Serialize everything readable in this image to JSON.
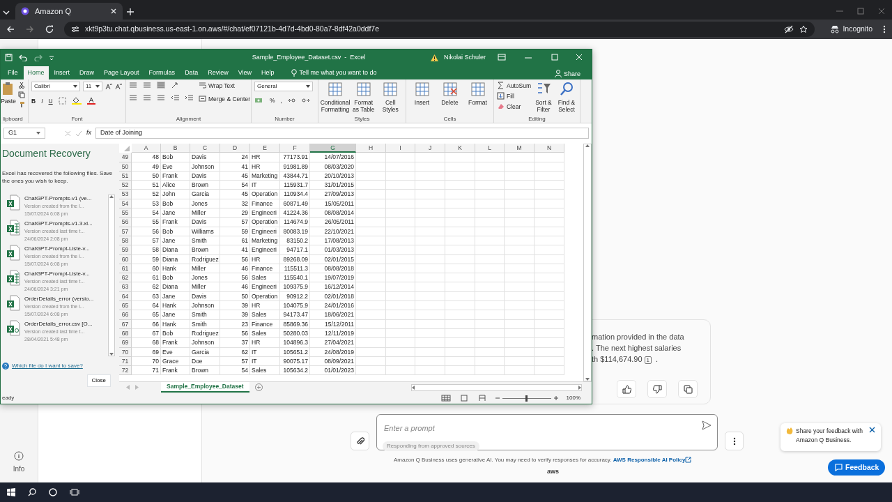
{
  "browser": {
    "tab_title": "Amazon Q",
    "url": "xkt9p3tu.chat.qbusiness.us-east-1.on.aws/#/chat/ef07121b-4d7d-4bd0-80a7-8df42a0ddf7e",
    "incognito": "Incognito"
  },
  "excel": {
    "title": "Sample_Employee_Dataset.csv  -  Excel",
    "user": "Nikolai Schuler",
    "tabs": [
      {
        "label": "File",
        "selected": false
      },
      {
        "label": "Home",
        "selected": true
      },
      {
        "label": "Insert",
        "selected": false
      },
      {
        "label": "Draw",
        "selected": false
      },
      {
        "label": "Page Layout",
        "selected": false
      },
      {
        "label": "Formulas",
        "selected": false
      },
      {
        "label": "Data",
        "selected": false
      },
      {
        "label": "Review",
        "selected": false
      },
      {
        "label": "View",
        "selected": false
      },
      {
        "label": "Help",
        "selected": false
      }
    ],
    "tell_me": "Tell me what you want to do",
    "share": "Share",
    "ribbon": [
      {
        "kind": "clipboard",
        "label": "lipboard",
        "buttons": [
          "Paste"
        ]
      },
      {
        "kind": "font",
        "label": "Font",
        "font": "Calibri",
        "size": "11",
        "styles": [
          "B",
          "I",
          "U"
        ]
      },
      {
        "kind": "alignment",
        "label": "Alignment",
        "buttons": [
          "Wrap Text",
          "Merge & Center"
        ]
      },
      {
        "kind": "number",
        "label": "Number",
        "format": "General",
        "symbols": [
          "%",
          ","
        ]
      },
      {
        "kind": "large",
        "label": "Styles",
        "buttons": [
          "Conditional Formatting",
          "Format as Table",
          "Cell Styles"
        ]
      },
      {
        "kind": "large",
        "label": "Cells",
        "buttons": [
          "Insert",
          "Delete",
          "Format"
        ]
      },
      {
        "kind": "editing",
        "label": "Editing",
        "small": [
          "AutoSum",
          "Fill",
          "Clear"
        ],
        "large": [
          "Sort & Filter",
          "Find & Select"
        ]
      }
    ],
    "name_box": "G1",
    "fx": "fx",
    "formula": "Date of Joining",
    "recovery": {
      "title": "Document Recovery",
      "message": "Excel has recovered the following files.  Save the ones you wish to keep.",
      "files": [
        {
          "kind": "sheet",
          "name": "ChatGPT-Prompts-v1 (ve...",
          "desc": "Version created from the l...",
          "date": "15/07/2024 6:08 pm"
        },
        {
          "kind": "grid",
          "name": "ChatGPT-Prompts-v1.3.xl...",
          "desc": "Version created last time t...",
          "date": "24/06/2024 2:08 pm"
        },
        {
          "kind": "sheet",
          "name": "ChatGPT-Prompt-Liste-v...",
          "desc": "Version created from the l...",
          "date": "15/07/2024 6:08 pm"
        },
        {
          "kind": "grid",
          "name": "ChatGPT-Prompt-Liste-v...",
          "desc": "Version created last time t...",
          "date": "24/06/2024 3:21 pm"
        },
        {
          "kind": "sheet",
          "name": "OrderDetails_error (versio...",
          "desc": "Version created from the l...",
          "date": "15/07/2024 6:08 pm"
        },
        {
          "kind": "text",
          "name": "OrderDetails_error.csv  [O...",
          "desc": "Version created last time t...",
          "date": "28/04/2021 5:48 pm"
        }
      ],
      "help_link": "Which file do I want to save?",
      "close": "Close"
    },
    "columns": [
      {
        "label": "A",
        "selected": false
      },
      {
        "label": "B",
        "selected": false
      },
      {
        "label": "C",
        "selected": false
      },
      {
        "label": "D",
        "selected": false
      },
      {
        "label": "E",
        "selected": false
      },
      {
        "label": "F",
        "selected": false
      },
      {
        "label": "G",
        "selected": true
      },
      {
        "label": "H",
        "selected": false
      },
      {
        "label": "I",
        "selected": false
      },
      {
        "label": "J",
        "selected": false
      },
      {
        "label": "K",
        "selected": false
      },
      {
        "label": "L",
        "selected": false
      },
      {
        "label": "M",
        "selected": false
      },
      {
        "label": "N",
        "selected": false
      }
    ],
    "rows": [
      {
        "num": "49",
        "cells": [
          "48",
          "Bob",
          "Davis",
          "24",
          "HR",
          "77173.91",
          "14/07/2016"
        ]
      },
      {
        "num": "50",
        "cells": [
          "49",
          "Eve",
          "Johnson",
          "41",
          "HR",
          "91981.89",
          "08/03/2020"
        ]
      },
      {
        "num": "51",
        "cells": [
          "50",
          "Frank",
          "Davis",
          "45",
          "Marketing",
          "43844.71",
          "20/10/2013"
        ]
      },
      {
        "num": "52",
        "cells": [
          "51",
          "Alice",
          "Brown",
          "54",
          "IT",
          "115931.7",
          "31/01/2015"
        ]
      },
      {
        "num": "53",
        "cells": [
          "52",
          "John",
          "Garcia",
          "45",
          "Operation",
          "110934.4",
          "27/09/2013"
        ]
      },
      {
        "num": "54",
        "cells": [
          "53",
          "Bob",
          "Jones",
          "32",
          "Finance",
          "60871.49",
          "15/05/2011"
        ]
      },
      {
        "num": "55",
        "cells": [
          "54",
          "Jane",
          "Miller",
          "29",
          "Engineeri",
          "41224.36",
          "08/08/2014"
        ]
      },
      {
        "num": "56",
        "cells": [
          "55",
          "Frank",
          "Davis",
          "57",
          "Operation",
          "114674.9",
          "26/05/2011"
        ]
      },
      {
        "num": "57",
        "cells": [
          "56",
          "Bob",
          "Williams",
          "59",
          "Engineeri",
          "80083.19",
          "22/10/2021"
        ]
      },
      {
        "num": "58",
        "cells": [
          "57",
          "Jane",
          "Smith",
          "61",
          "Marketing",
          "83150.2",
          "17/08/2013"
        ]
      },
      {
        "num": "59",
        "cells": [
          "58",
          "Diana",
          "Brown",
          "41",
          "Engineeri",
          "94717.1",
          "01/03/2013"
        ]
      },
      {
        "num": "60",
        "cells": [
          "59",
          "Diana",
          "Rodriguez",
          "56",
          "HR",
          "89268.09",
          "02/01/2015"
        ]
      },
      {
        "num": "61",
        "cells": [
          "60",
          "Hank",
          "Miller",
          "46",
          "Finance",
          "115511.3",
          "08/08/2018"
        ]
      },
      {
        "num": "62",
        "cells": [
          "61",
          "Bob",
          "Jones",
          "56",
          "Sales",
          "115540.1",
          "19/07/2019"
        ]
      },
      {
        "num": "63",
        "cells": [
          "62",
          "Diana",
          "Miller",
          "46",
          "Engineeri",
          "109375.9",
          "16/12/2014"
        ]
      },
      {
        "num": "64",
        "cells": [
          "63",
          "Jane",
          "Davis",
          "50",
          "Operation",
          "90912.2",
          "02/01/2018"
        ]
      },
      {
        "num": "65",
        "cells": [
          "64",
          "Hank",
          "Johnson",
          "39",
          "HR",
          "104075.9",
          "24/01/2016"
        ]
      },
      {
        "num": "66",
        "cells": [
          "65",
          "Jane",
          "Smith",
          "39",
          "Sales",
          "94173.47",
          "18/06/2021"
        ]
      },
      {
        "num": "67",
        "cells": [
          "66",
          "Hank",
          "Smith",
          "23",
          "Finance",
          "85869.36",
          "15/12/2011"
        ]
      },
      {
        "num": "68",
        "cells": [
          "67",
          "Bob",
          "Rodriguez",
          "56",
          "Sales",
          "50280.03",
          "12/11/2019"
        ]
      },
      {
        "num": "69",
        "cells": [
          "68",
          "Frank",
          "Johnson",
          "37",
          "HR",
          "104896.3",
          "27/04/2021"
        ]
      },
      {
        "num": "70",
        "cells": [
          "69",
          "Eve",
          "Garcia",
          "62",
          "IT",
          "105651.2",
          "24/08/2019"
        ]
      },
      {
        "num": "71",
        "cells": [
          "70",
          "Grace",
          "Doe",
          "57",
          "IT",
          "90075.17",
          "08/09/2021"
        ]
      },
      {
        "num": "72",
        "cells": [
          "71",
          "Frank",
          "Brown",
          "54",
          "Sales",
          "105634.2",
          "01/01/2023"
        ]
      }
    ],
    "sheet_tab": "Sample_Employee_Dataset",
    "status": "eady",
    "zoom": {
      "level": 0.5,
      "reading": "100%"
    }
  },
  "rail": {
    "info": "Info"
  },
  "chat": {
    "response_lines": [
      [
        "mation provided in the data"
      ],
      [
        ". The next highest salaries"
      ],
      [
        "th $114,674.90",
        {
          "cite": "1"
        },
        " ."
      ]
    ],
    "prompt": {
      "placeholder": "Enter a prompt",
      "chip": "Responding from approved sources"
    },
    "disclaimer": "Amazon Q Business uses generative AI. You may need to verify responses for accuracy.",
    "policy_link": "AWS Responsible AI Policy",
    "logo": "aws"
  },
  "feedback_popup": {
    "text": "Share your feedback with Amazon Q Business.",
    "button": "Feedback"
  }
}
